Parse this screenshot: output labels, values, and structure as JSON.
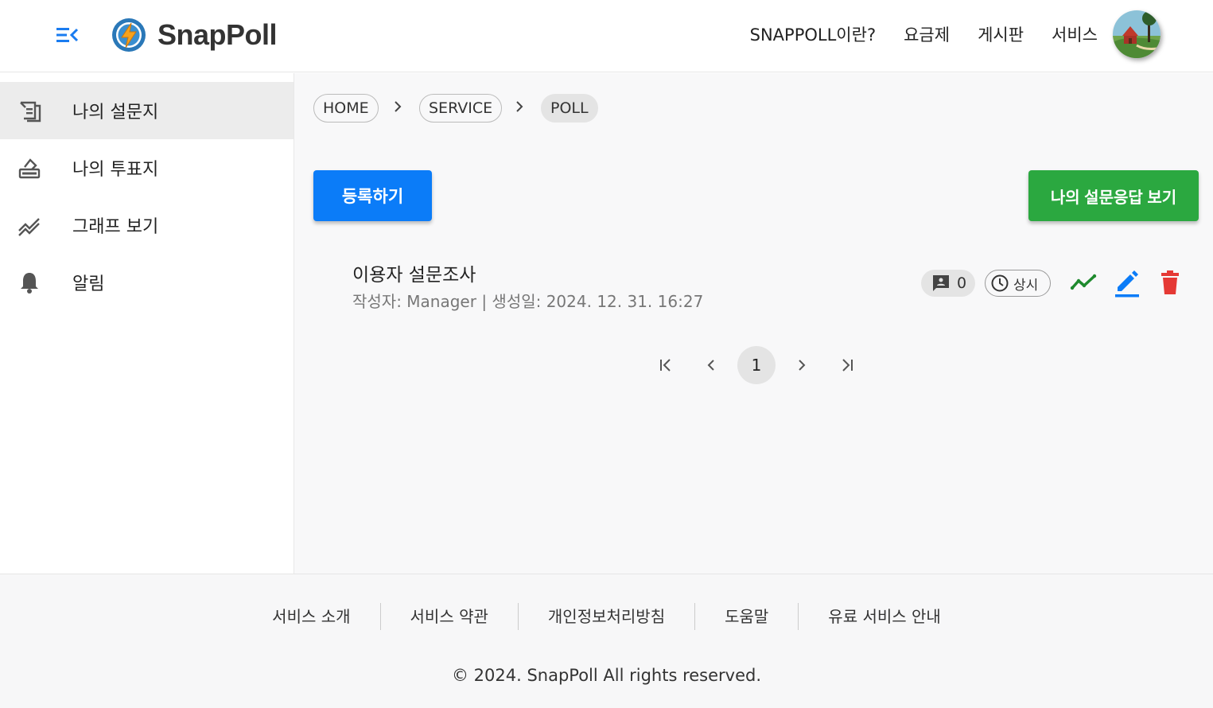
{
  "header": {
    "title": "SnapPoll",
    "nav": [
      "SNAPPOLL이란?",
      "요금제",
      "게시판",
      "서비스"
    ]
  },
  "sidebar": {
    "items": [
      {
        "label": "나의 설문지",
        "icon": "survey-icon",
        "active": true
      },
      {
        "label": "나의 투표지",
        "icon": "ballot-icon",
        "active": false
      },
      {
        "label": "그래프 보기",
        "icon": "graph-icon",
        "active": false
      },
      {
        "label": "알림",
        "icon": "bell-icon",
        "active": false
      }
    ]
  },
  "breadcrumb": [
    "HOME",
    "SERVICE",
    "POLL"
  ],
  "actions": {
    "register_label": "등록하기",
    "responses_label": "나의 설문응답 보기"
  },
  "poll": {
    "title": "이용자 설문조사",
    "meta": "작성자: Manager | 생성일: 2024. 12. 31. 16:27",
    "comment_count": "0",
    "status": "상시"
  },
  "pagination": {
    "current_page": "1"
  },
  "footer": {
    "links": [
      "서비스 소개",
      "서비스 약관",
      "개인정보처리방침",
      "도움말",
      "유료 서비스 안내"
    ],
    "copyright": "© 2024. SnapPoll All rights reserved."
  },
  "colors": {
    "primary_blue": "#0b7cf8",
    "success_green": "#2ba840",
    "delete_red": "#e53935",
    "graph_green": "#1f8a2e"
  }
}
